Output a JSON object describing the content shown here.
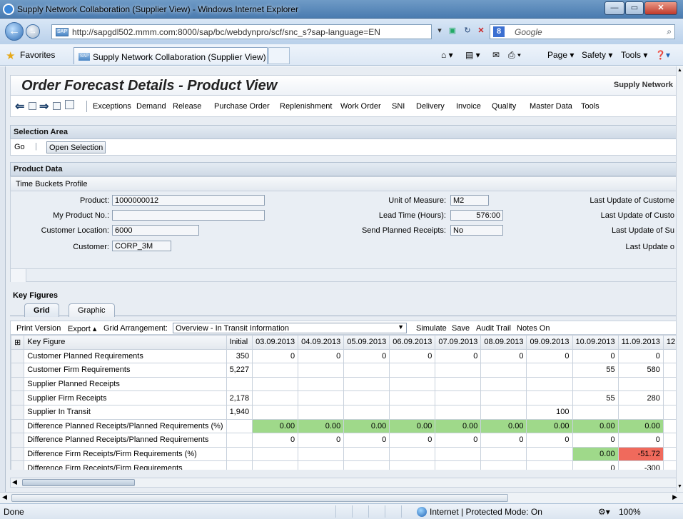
{
  "window": {
    "title": "Supply Network Collaboration (Supplier View) - Windows Internet Explorer"
  },
  "browser": {
    "url": "http://sapgdl502.mmm.com:8000/sap/bc/webdynpro/scf/snc_s?sap-language=EN",
    "search_placeholder": "Google",
    "favorites_label": "Favorites",
    "tab_title": "Supply Network Collaboration (Supplier View)",
    "page_menu": "Page ▾",
    "safety_menu": "Safety ▾",
    "tools_menu": "Tools ▾"
  },
  "app": {
    "title": "Order Forecast Details - Product View",
    "product_name": "Supply Network",
    "menu": [
      "Exceptions",
      "Demand",
      "Release",
      "Purchase Order",
      "Replenishment",
      "Work Order",
      "SNI",
      "Delivery",
      "Invoice",
      "Quality",
      "Master Data",
      "Tools"
    ]
  },
  "selection": {
    "header": "Selection Area",
    "go": "Go",
    "open_selection": "Open Selection"
  },
  "product_data": {
    "header": "Product Data",
    "profile": "Time Buckets Profile",
    "product_label": "Product:",
    "product_value": "1000000012",
    "my_product_label": "My Product No.:",
    "my_product_value": "",
    "customer_location_label": "Customer Location:",
    "customer_location_value": "6000",
    "customer_label": "Customer:",
    "customer_value": "CORP_3M",
    "uom_label": "Unit of Measure:",
    "uom_value": "M2",
    "lead_time_label": "Lead Time (Hours):",
    "lead_time_value": "576:00",
    "send_planned_label": "Send Planned Receipts:",
    "send_planned_value": "No",
    "last_update_1": "Last Update of Custome",
    "last_update_2": "Last Update of Custo",
    "last_update_3": "Last Update of Su",
    "last_update_4": "Last Update o"
  },
  "key_figures": {
    "header": "Key Figures",
    "tab_grid": "Grid",
    "tab_graphic": "Graphic",
    "print_version": "Print Version",
    "export": "Export ▴",
    "grid_arrangement_label": "Grid Arrangement:",
    "grid_arrangement_value": "Overview - In Transit Information",
    "simulate": "Simulate",
    "save": "Save",
    "audit_trail": "Audit Trail",
    "notes_on": "Notes On",
    "columns": [
      "Key Figure",
      "Initial",
      "03.09.2013",
      "04.09.2013",
      "05.09.2013",
      "06.09.2013",
      "07.09.2013",
      "08.09.2013",
      "09.09.2013",
      "10.09.2013",
      "11.09.2013",
      "12.09.20"
    ],
    "rows": [
      {
        "label": "Customer Planned Requirements",
        "cells": [
          "350",
          "0",
          "0",
          "0",
          "0",
          "0",
          "0",
          "0",
          "0",
          "0",
          ""
        ]
      },
      {
        "label": "Customer Firm Requirements",
        "cells": [
          "5,227",
          "",
          "",
          "",
          "",
          "",
          "",
          "",
          "55",
          "580",
          ""
        ]
      },
      {
        "label": "Supplier Planned Receipts",
        "cells": [
          "",
          "",
          "",
          "",
          "",
          "",
          "",
          "",
          "",
          "",
          ""
        ]
      },
      {
        "label": "Supplier Firm Receipts",
        "cells": [
          "2,178",
          "",
          "",
          "",
          "",
          "",
          "",
          "",
          "55",
          "280",
          ""
        ]
      },
      {
        "label": "Supplier In Transit",
        "cells": [
          "1,940",
          "",
          "",
          "",
          "",
          "",
          "",
          "100",
          "",
          "",
          ""
        ]
      },
      {
        "label": "Difference Planned Receipts/Planned Requirements (%)",
        "cells": [
          "",
          "0.00",
          "0.00",
          "0.00",
          "0.00",
          "0.00",
          "0.00",
          "0.00",
          "0.00",
          "0.00",
          ""
        ]
      },
      {
        "label": "Difference Planned Receipts/Planned Requirements",
        "cells": [
          "",
          "0",
          "0",
          "0",
          "0",
          "0",
          "0",
          "0",
          "0",
          "0",
          ""
        ]
      },
      {
        "label": "Difference Firm Receipts/Firm Requirements (%)",
        "cells": [
          "",
          "",
          "",
          "",
          "",
          "",
          "",
          "",
          "0.00",
          "-51.72",
          ""
        ]
      },
      {
        "label": "Difference Firm Receipts/Firm Requirements",
        "cells": [
          "",
          "",
          "",
          "",
          "",
          "",
          "",
          "",
          "0",
          "-300",
          ""
        ]
      }
    ],
    "colors": {
      "positive": "#9fd98a",
      "negative": "#f06a5c"
    }
  },
  "status": {
    "left": "Done",
    "zone": "Internet | Protected Mode: On",
    "zoom": "100%"
  }
}
